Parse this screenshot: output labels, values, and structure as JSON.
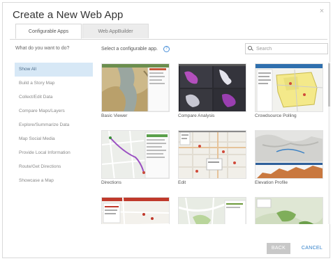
{
  "dialog": {
    "title": "Create a New Web App",
    "close_glyph": "×"
  },
  "tabs": [
    {
      "label": "Configurable Apps",
      "active": true
    },
    {
      "label": "Web AppBuilder",
      "active": false
    }
  ],
  "sidebar": {
    "question": "What do you want to do?",
    "items": [
      {
        "label": "Show All",
        "selected": true
      },
      {
        "label": "Build a Story Map"
      },
      {
        "label": "Collect/Edit Data"
      },
      {
        "label": "Compare Maps/Layers"
      },
      {
        "label": "Explore/Summarize Data"
      },
      {
        "label": "Map Social Media"
      },
      {
        "label": "Provide Local Information"
      },
      {
        "label": "Route/Get Directions"
      },
      {
        "label": "Showcase a Map"
      }
    ]
  },
  "main": {
    "prompt": "Select a configurable app.",
    "help_glyph": "?",
    "search_placeholder": "Search",
    "apps": [
      {
        "label": "Basic Viewer"
      },
      {
        "label": "Compare Analysis"
      },
      {
        "label": "Crowdsource Polling"
      },
      {
        "label": "Directions"
      },
      {
        "label": "Edit"
      },
      {
        "label": "Elevation Profile"
      },
      {
        "label": ""
      },
      {
        "label": ""
      },
      {
        "label": ""
      }
    ]
  },
  "footer": {
    "back_label": "BACK",
    "cancel_label": "CANCEL"
  },
  "colors": {
    "selected_item_bg": "#d7e8f6",
    "link_blue": "#2f7fc9",
    "back_button_bg": "#c8c8c8"
  }
}
